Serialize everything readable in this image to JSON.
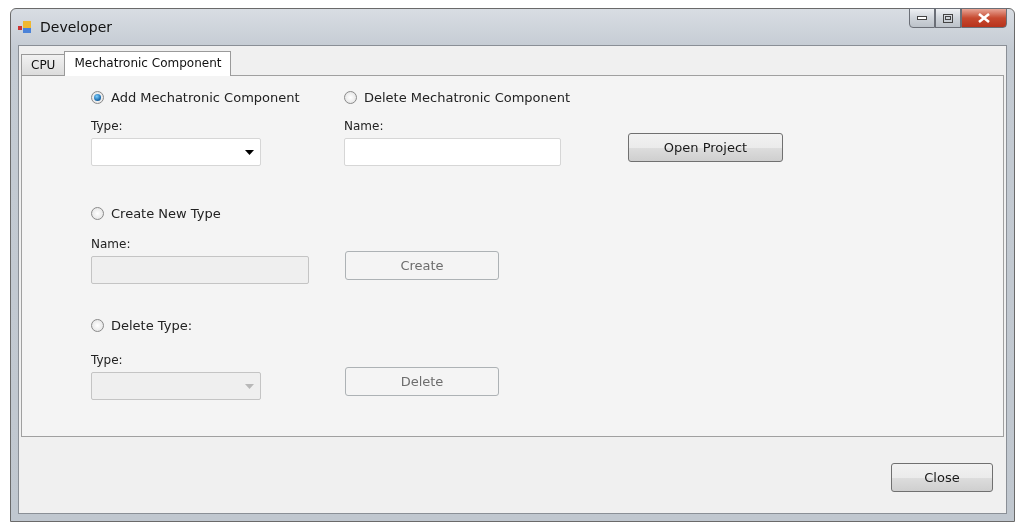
{
  "window": {
    "title": "Developer"
  },
  "tabs": [
    {
      "label": "CPU",
      "selected": false
    },
    {
      "label": "Mechatronic Component",
      "selected": true
    }
  ],
  "component": {
    "modes": [
      {
        "label": "Add Mechatronic Component",
        "selected": true
      },
      {
        "label": "Delete Mechatronic Component",
        "selected": false
      }
    ],
    "type_field": {
      "label": "Type:",
      "kind": "dropdown",
      "disabled": false
    },
    "name_field": {
      "label": "Name:",
      "kind": "text",
      "disabled": false
    },
    "open_button": {
      "label": "Open Project",
      "disabled": false
    }
  },
  "sections": [
    {
      "radio": {
        "label": "Create New Type",
        "selected": false
      },
      "field": {
        "label": "Name:",
        "kind": "text",
        "disabled": true
      },
      "button": {
        "label": "Create",
        "disabled": true
      }
    },
    {
      "radio": {
        "label": "Delete Type:",
        "selected": false
      },
      "field": {
        "label": "Type:",
        "kind": "dropdown",
        "disabled": true
      },
      "button": {
        "label": "Delete",
        "disabled": true
      }
    }
  ],
  "close_button": {
    "label": "Close",
    "disabled": false
  }
}
